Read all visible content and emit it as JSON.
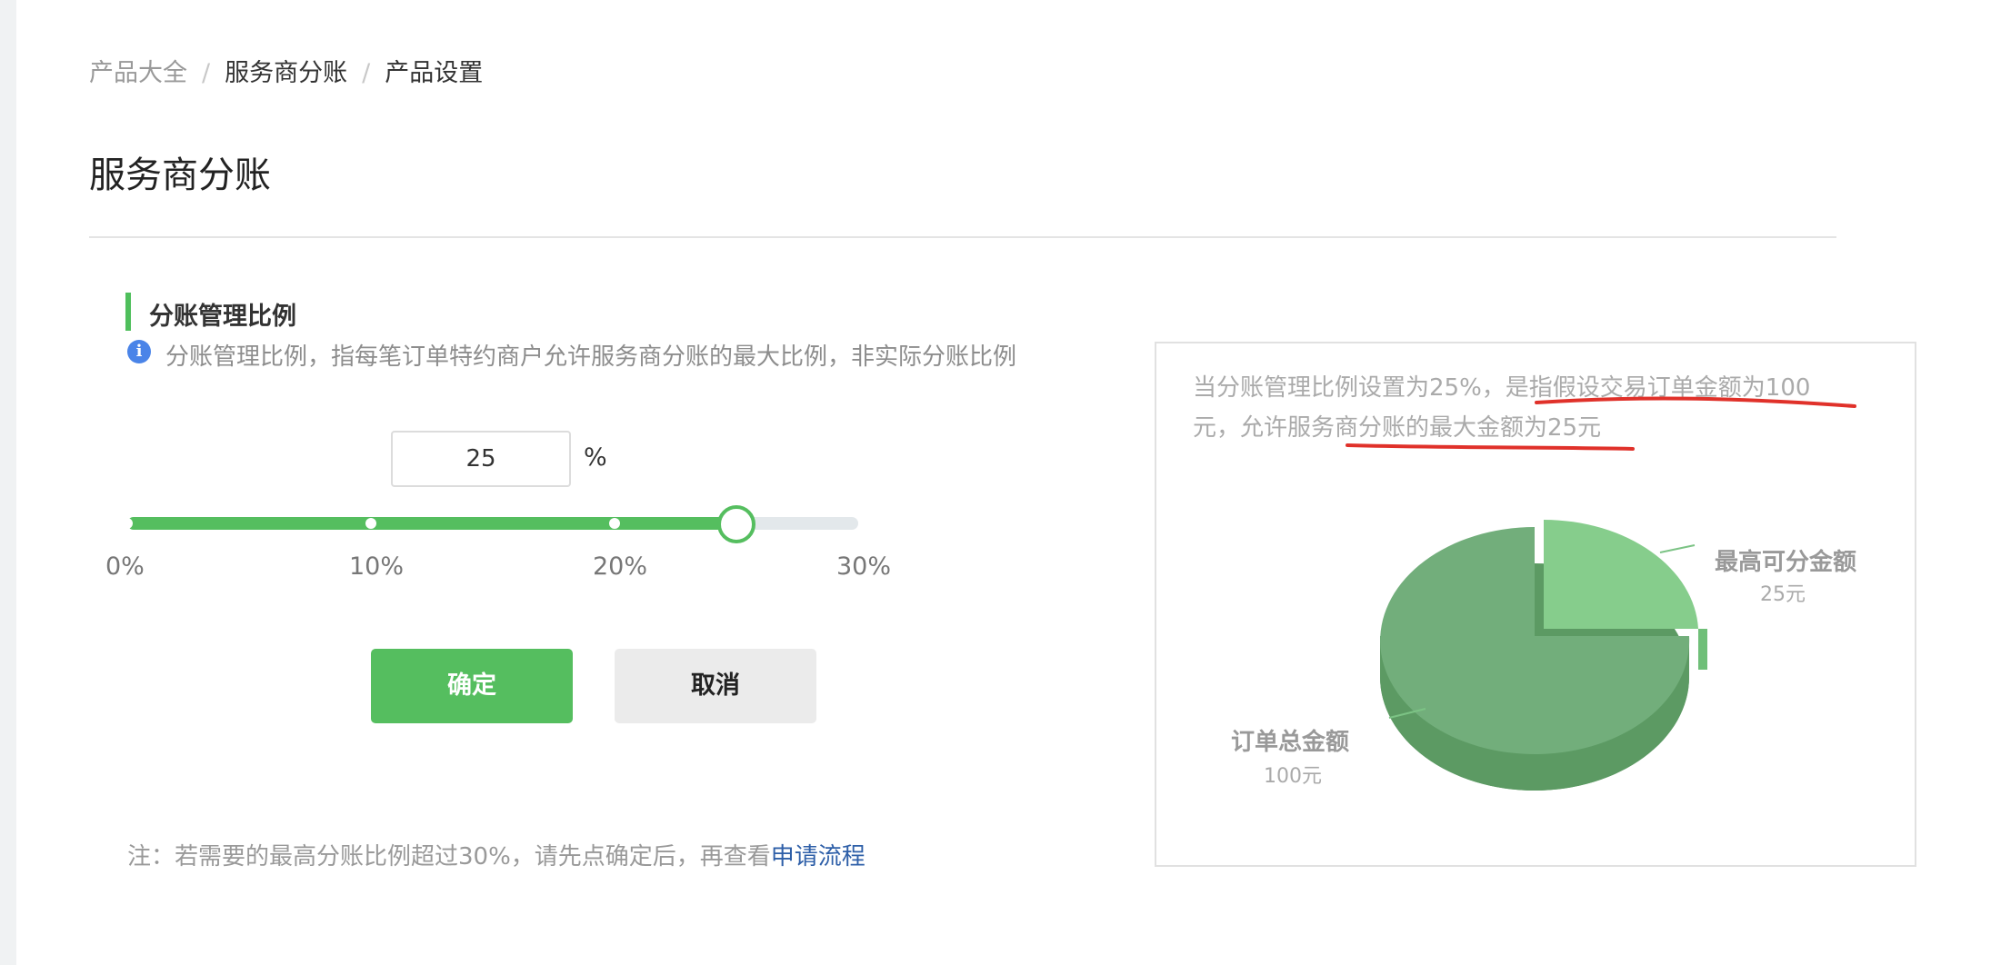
{
  "breadcrumb": {
    "items": [
      "产品大全",
      "服务商分账",
      "产品设置"
    ],
    "separator": "/"
  },
  "page": {
    "title": "服务商分账"
  },
  "section": {
    "title": "分账管理比例",
    "info_icon": "info-icon",
    "info_text": "分账管理比例，指每笔订单特约商户允许服务商分账的最大比例，非实际分账比例"
  },
  "ratio": {
    "value": "25",
    "unit": "%",
    "slider": {
      "min": 0,
      "max": 30,
      "value": 25,
      "ticks": [
        "0%",
        "10%",
        "20%",
        "30%"
      ]
    }
  },
  "buttons": {
    "confirm": "确定",
    "cancel": "取消"
  },
  "note": {
    "text": "注：若需要的最高分账比例超过30%，请先点确定后，再查看",
    "link": "申请流程"
  },
  "explain": {
    "line1_plain": "当分账管理比例设置为25%，",
    "line1_marked": "是指假设交易订单金额为100",
    "line2_plain": "元，允许服务商分账的",
    "line2_marked": "最大金额为25元"
  },
  "chart_data": {
    "type": "pie",
    "categories": [
      "最高可分金额",
      "订单总金额"
    ],
    "labels": [
      {
        "name": "最高可分金额",
        "value_text": "25元"
      },
      {
        "name": "订单总金额",
        "value_text": "100元"
      }
    ],
    "values": [
      25,
      75
    ],
    "colors": [
      "#86cd8c",
      "#72ae7b"
    ]
  },
  "colors": {
    "accent": "#55be5f",
    "link": "#2e5fa8",
    "info": "#4a84e8",
    "underline_mark": "#e0312a"
  }
}
